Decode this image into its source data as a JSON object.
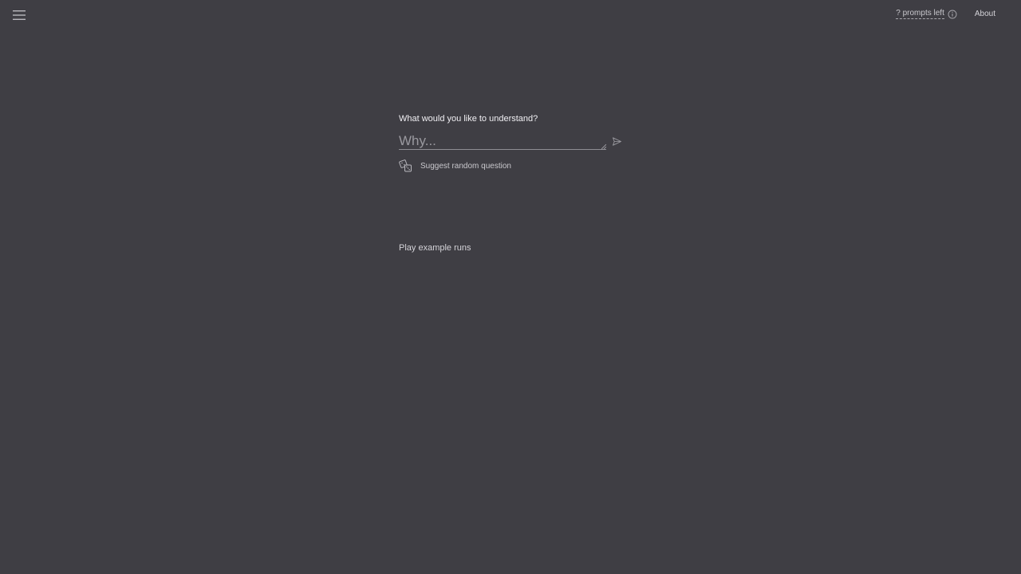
{
  "header": {
    "menu_icon": "hamburger-menu-icon",
    "prompts_left": "? prompts left",
    "info_icon": "info-circle-icon",
    "about_label": "About"
  },
  "main": {
    "question_label": "What would you like to understand?",
    "input": {
      "value": "",
      "placeholder": "Why..."
    },
    "send_icon": "send-arrow-icon",
    "suggest": {
      "icon": "dice-icon",
      "label": "Suggest random question"
    },
    "examples_heading": "Play example runs"
  },
  "colors": {
    "background": "#3f3e44",
    "text": "#d8d7dc",
    "label": "#f1f0f4"
  }
}
